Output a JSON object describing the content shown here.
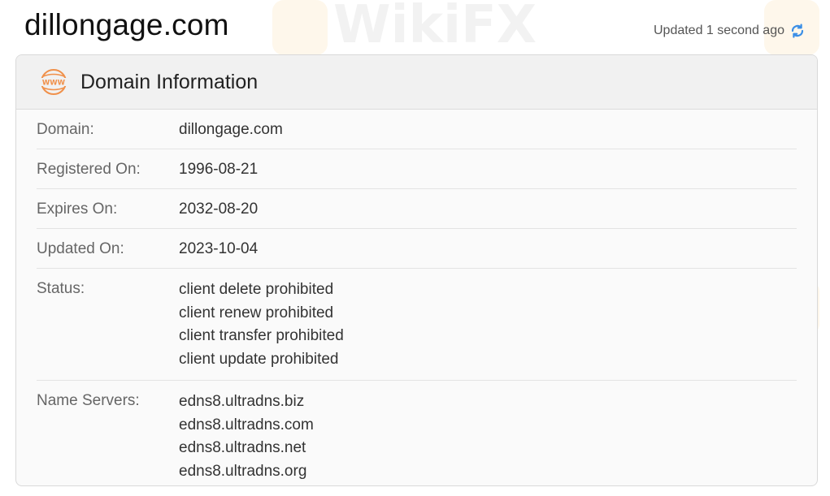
{
  "page": {
    "title": "dillongage.com",
    "updated_text": "Updated 1 second ago"
  },
  "card": {
    "title": "Domain Information",
    "icon_label": "WWW",
    "rows": [
      {
        "label": "Domain:",
        "values": [
          "dillongage.com"
        ]
      },
      {
        "label": "Registered On:",
        "values": [
          "1996-08-21"
        ]
      },
      {
        "label": "Expires On:",
        "values": [
          "2032-08-20"
        ]
      },
      {
        "label": "Updated On:",
        "values": [
          "2023-10-04"
        ]
      },
      {
        "label": "Status:",
        "values": [
          "client delete prohibited",
          "client renew prohibited",
          "client transfer prohibited",
          "client update prohibited"
        ]
      },
      {
        "label": "Name Servers:",
        "values": [
          "edns8.ultradns.biz",
          "edns8.ultradns.com",
          "edns8.ultradns.net",
          "edns8.ultradns.org"
        ]
      }
    ]
  },
  "watermark": {
    "text": "WikiFX"
  },
  "colors": {
    "accent_orange": "#f0904a",
    "refresh_blue": "#3a8ee6"
  }
}
